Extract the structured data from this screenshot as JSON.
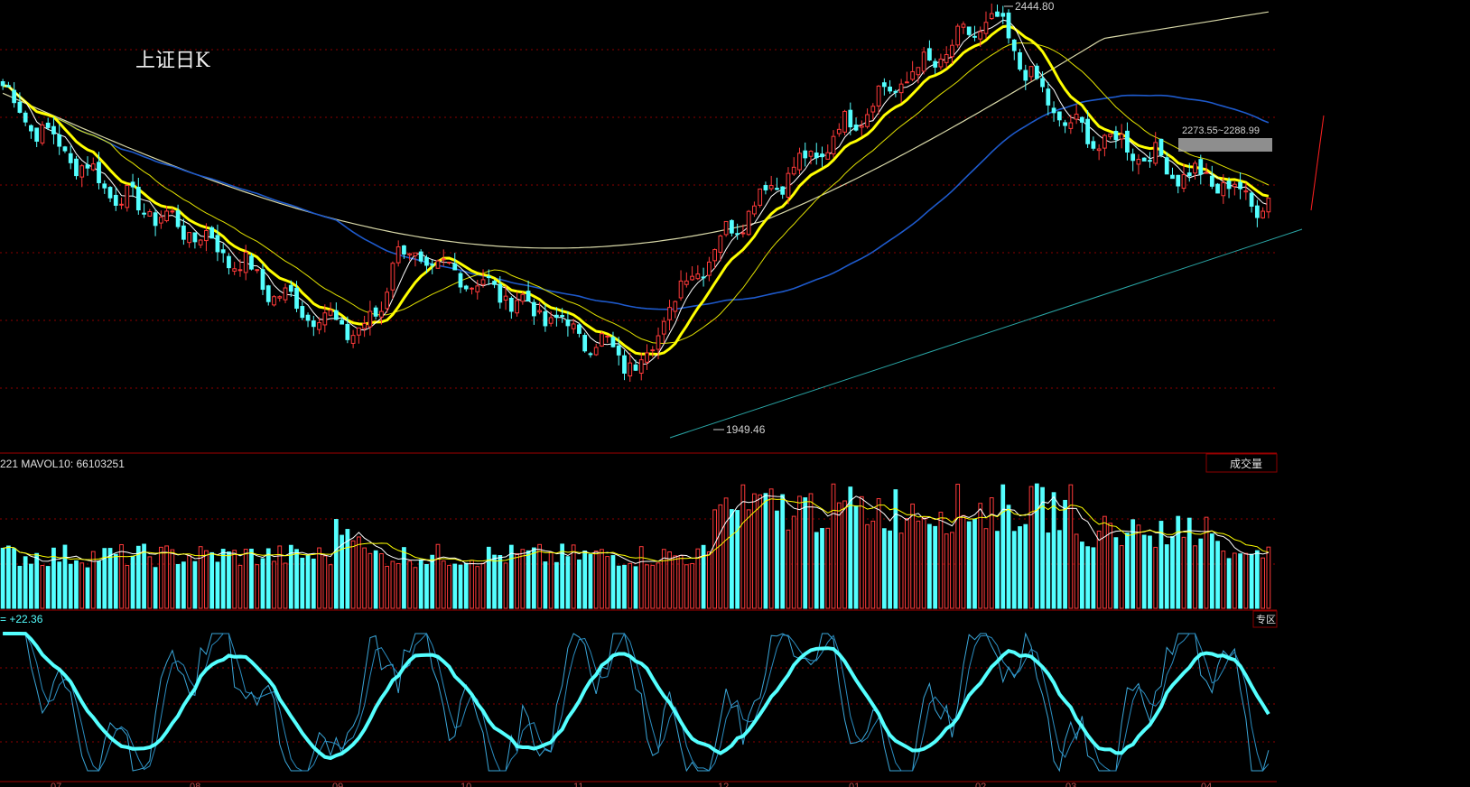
{
  "chart_data": {
    "type": "candlestick",
    "title": "上证日K",
    "price_panel": {
      "high_label": "2444.80",
      "low_label": "1949.46",
      "zone_label": "2273.55~2288.99",
      "ylim": [
        1920,
        2460
      ],
      "approx_closes": [
        2360,
        2330,
        2315,
        2300,
        2285,
        2270,
        2255,
        2240,
        2228,
        2215,
        2205,
        2200,
        2190,
        2180,
        2172,
        2165,
        2150,
        2140,
        2128,
        2110,
        2098,
        2085,
        2078,
        2070,
        2060,
        2052,
        2050,
        2046,
        2070,
        2150,
        2140,
        2135,
        2128,
        2120,
        2120,
        2110,
        2100,
        2095,
        2088,
        2075,
        2068,
        2060,
        2050,
        2040,
        2030,
        2024,
        2012,
        2000,
        2020,
        2060,
        2090,
        2115,
        2135,
        2155,
        2175,
        2195,
        2215,
        2230,
        2245,
        2255,
        2265,
        2280,
        2300,
        2316,
        2330,
        2345,
        2356,
        2368,
        2380,
        2390,
        2400,
        2415,
        2430,
        2440,
        2435,
        2410,
        2380,
        2350,
        2330,
        2312,
        2300,
        2292,
        2290,
        2285,
        2280,
        2270,
        2262,
        2252,
        2245,
        2242,
        2238,
        2230,
        2220,
        2212,
        2210
      ]
    },
    "volume_panel": {
      "label": "成交量",
      "info_text": "221 MAVOL10: 66103251",
      "tag_text": "专区"
    },
    "indicator_panel": {
      "info_text": "= +22.36"
    },
    "x_tick_labels": [
      "07",
      "08",
      "09",
      "10",
      "11",
      "12",
      "01",
      "02",
      "03",
      "04"
    ],
    "colors": {
      "up": "#ff3a3a",
      "down": "#54ffff",
      "ma5": "#ffffff",
      "ma10": "#ffff00",
      "ma20": "#e0e000",
      "ma60": "#1e5acc",
      "ma250": "#d8d8a8",
      "trendline": "#2aa7a7",
      "grid": "#8b0000"
    }
  }
}
